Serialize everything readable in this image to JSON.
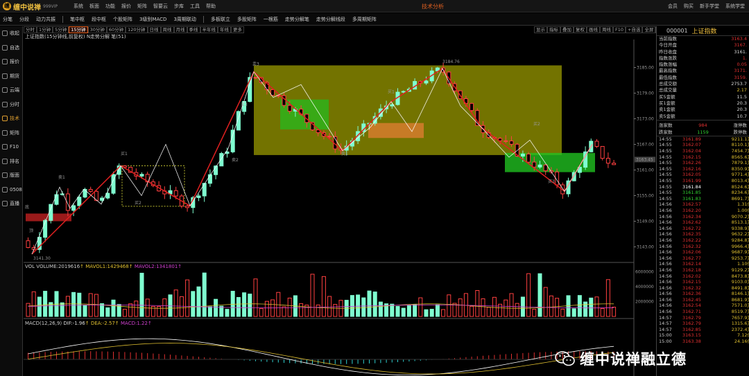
{
  "app": {
    "logo_text": "缠中说禅",
    "logo_badge": "999VIP",
    "window_title": "技术分析",
    "menu": [
      "系统",
      "板面",
      "功能",
      "报价",
      "矩阵",
      "智要云",
      "步库",
      "工具",
      "帮助"
    ],
    "window_buttons": [
      "会员",
      "购买",
      "新手学堂",
      "系统学堂"
    ]
  },
  "toolbar": {
    "items": [
      "分笔",
      "分段",
      "动力共振",
      "笔中枢",
      "段中枢",
      "个股矩阵",
      "3级别MACD",
      "3周期联动",
      "多板联立",
      "多股矩阵",
      "一根筋",
      "走势分解笔",
      "走势分解线段",
      "多周期矩阵"
    ]
  },
  "sidebar": {
    "items": [
      {
        "label": "收起",
        "icon": "collapse-icon"
      },
      {
        "label": "自选",
        "icon": "star-icon"
      },
      {
        "label": "报价",
        "icon": "quote-icon"
      },
      {
        "label": "期货",
        "icon": "futures-icon"
      },
      {
        "label": "云端",
        "icon": "cloud-icon"
      },
      {
        "label": "分时",
        "icon": "clock-icon"
      },
      {
        "label": "技术",
        "icon": "candle-icon"
      },
      {
        "label": "矩阵",
        "icon": "grid-icon"
      },
      {
        "label": "F10",
        "icon": "f10-icon"
      },
      {
        "label": "排名",
        "icon": "ranking-icon"
      },
      {
        "label": "版面",
        "icon": "layout-icon"
      },
      {
        "label": "0508",
        "icon": "chart-icon"
      },
      {
        "label": "直播",
        "icon": "live-icon"
      }
    ],
    "active_index": 6
  },
  "periods": {
    "items": [
      "分时",
      "1分钟",
      "5分钟",
      "15分钟",
      "30分钟",
      "60分钟",
      "120分钟",
      "日线",
      "周线",
      "月线",
      "季线",
      "半年线",
      "年线",
      "更多"
    ],
    "active_index": 3
  },
  "chart_tools": [
    "显示",
    "指标",
    "叠加",
    "复权",
    "画线",
    "周线",
    "F10",
    "+自选",
    "全屏",
    "返回"
  ],
  "chart": {
    "caption": "上证指数(15分钟线,前复权) N走势分解 笔(51)",
    "high_label": "3184.76",
    "low_label": "3141.30",
    "price_axis": [
      "3185.00",
      "3179.00",
      "3173.00",
      "3167.00",
      "3161.00",
      "3155.00",
      "3149.00",
      "3143.00"
    ],
    "last_price": "3163.45",
    "stroke_labels": [
      "顶",
      "底",
      "卖1",
      "买1",
      "买2",
      "卖2",
      "卖3",
      "买3",
      "卖1",
      "买1",
      "买2",
      "买3"
    ],
    "colors": {
      "up": "#7fffd0",
      "down": "#ff4040",
      "stroke": "#e02020",
      "zone_yellow": "#9a9a00",
      "zone_green": "#20c020",
      "zone_orange": "#ff8040"
    }
  },
  "volume": {
    "name": "VOL VOLUME:2019616",
    "mavol1": "MAVOL1:1429468",
    "mavol2": "MAVOL2:1341801",
    "axis": [
      "6000000",
      "4000000",
      "2000000"
    ]
  },
  "macd": {
    "name": "MACD(12,26,9)",
    "dif": "DIF:-1.96",
    "dea": "DEA:-2.57",
    "macd": "MACD:1.22",
    "axis": [
      "-0.90",
      "-0.96"
    ]
  },
  "quote": {
    "code": "000001",
    "name": "上证指数",
    "rows": [
      {
        "label": "当前指数",
        "value": "3163.4",
        "color": "r"
      },
      {
        "label": "今日开盘",
        "value": "3167.",
        "color": "r"
      },
      {
        "label": "昨日收盘",
        "value": "3161.",
        "color": "w"
      },
      {
        "label": "指数涨跌",
        "value": "1.",
        "color": "r"
      },
      {
        "label": "指数涨幅",
        "value": "0.05",
        "color": "r"
      },
      {
        "label": "最高指数",
        "value": "3171.",
        "color": "r"
      },
      {
        "label": "最低指数",
        "value": "3159.",
        "color": "r"
      },
      {
        "label": "总成交额",
        "value": "2753.7",
        "color": "w"
      },
      {
        "label": "总成交量",
        "value": "2.17",
        "color": "y"
      },
      {
        "label": "买5金额",
        "value": "11.5",
        "color": "w"
      },
      {
        "label": "买1金额",
        "value": "20.3",
        "color": "w"
      },
      {
        "label": "卖1金额",
        "value": "20.3",
        "color": "w"
      },
      {
        "label": "卖5金额",
        "value": "10.7",
        "color": "w"
      }
    ],
    "up_label": "涨家数",
    "up_count": "984",
    "flat_label": "涨停数",
    "down_label": "跌家数",
    "down_count": "1159",
    "limit_down_label": "跌停数"
  },
  "ticks": [
    {
      "t": "14:55",
      "p": "3161.89",
      "v": "9211.1万",
      "c": "r"
    },
    {
      "t": "14:55",
      "p": "3162.07",
      "v": "8110.1万",
      "c": "r"
    },
    {
      "t": "14:55",
      "p": "3162.04",
      "v": "7454.7万",
      "c": "r"
    },
    {
      "t": "14:55",
      "p": "3162.15",
      "v": "8565.6万",
      "c": "r"
    },
    {
      "t": "14:55",
      "p": "3162.26",
      "v": "7879.1万",
      "c": "r"
    },
    {
      "t": "14:55",
      "p": "3162.16",
      "v": "8350.9万",
      "c": "r"
    },
    {
      "t": "14:55",
      "p": "3162.05",
      "v": "9771.4万",
      "c": "r"
    },
    {
      "t": "14:55",
      "p": "3161.99",
      "v": "8013.4万",
      "c": "r"
    },
    {
      "t": "14:55",
      "p": "3161.84",
      "v": "8524.6万",
      "c": "w"
    },
    {
      "t": "14:55",
      "p": "3161.85",
      "v": "8234.6万",
      "c": "g"
    },
    {
      "t": "14:55",
      "p": "3161.83",
      "v": "8691.7万",
      "c": "g"
    },
    {
      "t": "14:56",
      "p": "3162.57",
      "v": "1.31亿",
      "c": "r"
    },
    {
      "t": "14:56",
      "p": "3162.20",
      "v": "1.00亿",
      "c": "r"
    },
    {
      "t": "14:56",
      "p": "3162.34",
      "v": "9070.2万",
      "c": "r"
    },
    {
      "t": "14:56",
      "p": "3162.62",
      "v": "8513.1万",
      "c": "r"
    },
    {
      "t": "14:56",
      "p": "3162.72",
      "v": "9338.9万",
      "c": "r"
    },
    {
      "t": "14:56",
      "p": "3162.35",
      "v": "9632.2万",
      "c": "r"
    },
    {
      "t": "14:56",
      "p": "3162.22",
      "v": "9284.8万",
      "c": "r"
    },
    {
      "t": "14:56",
      "p": "3162.32",
      "v": "9966.4万",
      "c": "r"
    },
    {
      "t": "14:56",
      "p": "3162.06",
      "v": "9687.9万",
      "c": "r"
    },
    {
      "t": "14:56",
      "p": "3162.77",
      "v": "9253.7万",
      "c": "r"
    },
    {
      "t": "14:56",
      "p": "3162.14",
      "v": "1.10亿",
      "c": "r"
    },
    {
      "t": "14:56",
      "p": "3162.18",
      "v": "9129.2万",
      "c": "r"
    },
    {
      "t": "14:56",
      "p": "3162.02",
      "v": "8473.8万",
      "c": "r"
    },
    {
      "t": "14:56",
      "p": "3162.15",
      "v": "9103.0万",
      "c": "r"
    },
    {
      "t": "14:56",
      "p": "3162.32",
      "v": "8491.8万",
      "c": "r"
    },
    {
      "t": "14:56",
      "p": "3162.36",
      "v": "8146.1万",
      "c": "r"
    },
    {
      "t": "14:56",
      "p": "3162.45",
      "v": "8681.9万",
      "c": "r"
    },
    {
      "t": "14:56",
      "p": "3162.54",
      "v": "7571.0万",
      "c": "r"
    },
    {
      "t": "14:56",
      "p": "3162.71",
      "v": "8519.7万",
      "c": "r"
    },
    {
      "t": "14:57",
      "p": "3162.79",
      "v": "7657.9万",
      "c": "r"
    },
    {
      "t": "14:57",
      "p": "3162.79",
      "v": "1315.6万",
      "c": "r"
    },
    {
      "t": "14:57",
      "p": "3162.85",
      "v": "2372.4万",
      "c": "r"
    },
    {
      "t": "15:00",
      "p": "3163.15",
      "v": "7.12亿",
      "c": "r"
    },
    {
      "t": "15:00",
      "p": "3163.38",
      "v": "24.16亿",
      "c": "r"
    }
  ],
  "watermark": {
    "text": "缠中说禅融立德",
    "icon": "wechat-icon"
  }
}
